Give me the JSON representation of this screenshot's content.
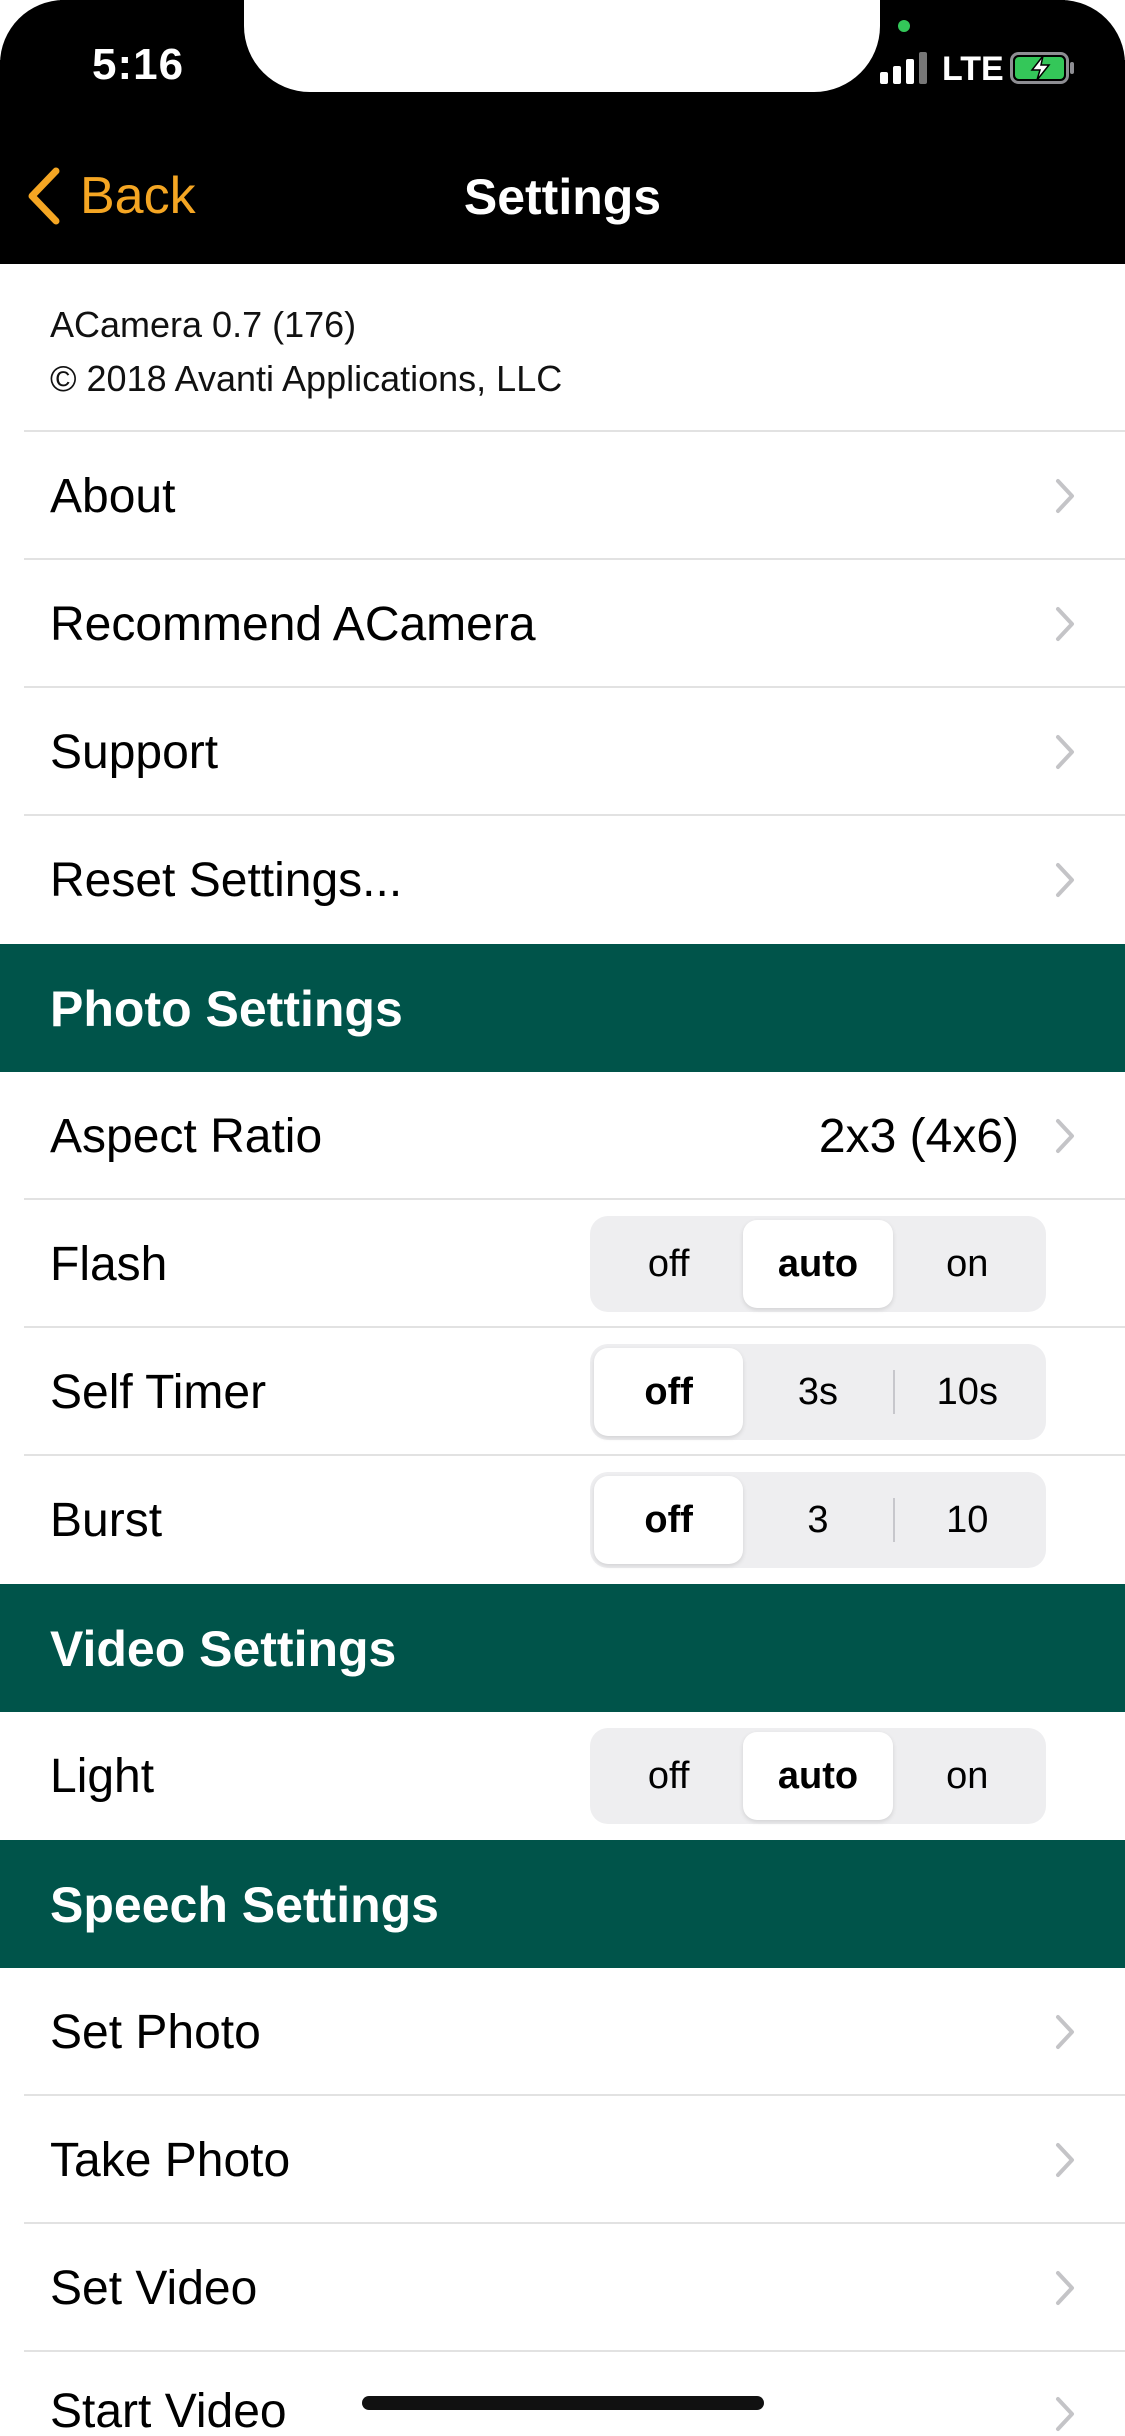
{
  "status_bar": {
    "time": "5:16",
    "network": "LTE"
  },
  "nav": {
    "back_label": "Back",
    "title": "Settings",
    "accent_color": "#f5a623"
  },
  "app_info": {
    "version": "ACamera 0.7 (176)",
    "copyright": "© 2018 Avanti Applications, LLC"
  },
  "menu": [
    {
      "label": "About"
    },
    {
      "label": "Recommend ACamera"
    },
    {
      "label": "Support"
    },
    {
      "label": "Reset Settings..."
    }
  ],
  "photo_settings": {
    "header": "Photo Settings",
    "aspect_ratio": {
      "label": "Aspect Ratio",
      "value": "2x3 (4x6)"
    },
    "flash": {
      "label": "Flash",
      "options": [
        "off",
        "auto",
        "on"
      ],
      "selected": "auto"
    },
    "self_timer": {
      "label": "Self Timer",
      "options": [
        "off",
        "3s",
        "10s"
      ],
      "selected": "off"
    },
    "burst": {
      "label": "Burst",
      "options": [
        "off",
        "3",
        "10"
      ],
      "selected": "off"
    }
  },
  "video_settings": {
    "header": "Video Settings",
    "light": {
      "label": "Light",
      "options": [
        "off",
        "auto",
        "on"
      ],
      "selected": "auto"
    }
  },
  "speech_settings": {
    "header": "Speech Settings",
    "items": [
      {
        "label": "Set Photo"
      },
      {
        "label": "Take Photo"
      },
      {
        "label": "Set Video"
      },
      {
        "label": "Start Video"
      }
    ]
  },
  "colors": {
    "section_header": "#00544a",
    "nav_background": "#000000"
  }
}
